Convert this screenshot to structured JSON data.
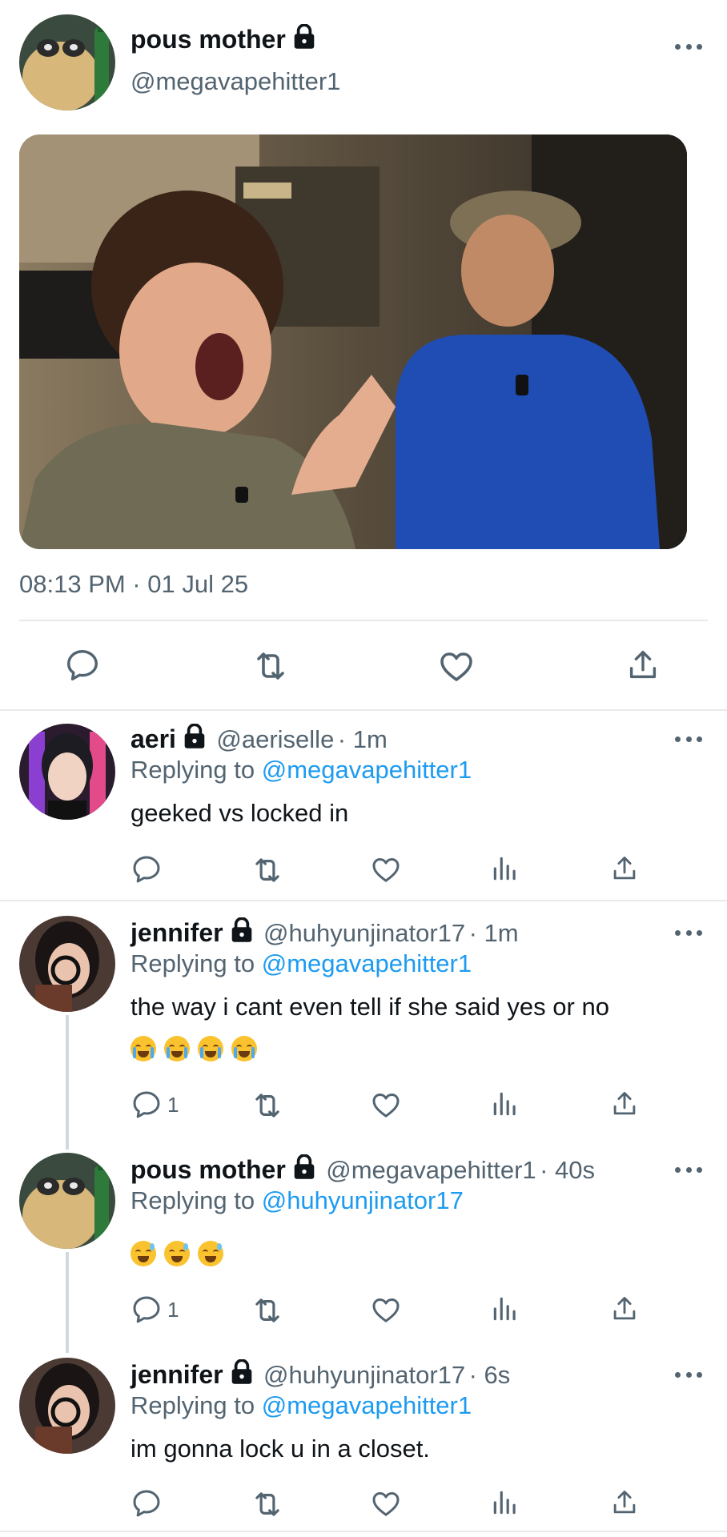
{
  "main_tweet": {
    "author_name": "pous mother",
    "handle": "@megavapehitter1",
    "timestamp": "08:13 PM · 01 Jul 25",
    "image_alt": "photo of two young men, one yelling at the camera, one in a blue shirt and cap"
  },
  "replies": [
    {
      "name": "aeri",
      "handle": "@aeriselle",
      "time": "· 1m",
      "replying_label": "Replying to",
      "replying_to": "@megavapehitter1",
      "text": "geeked vs locked in",
      "reply_count": ""
    },
    {
      "name": "jennifer",
      "handle": "@huhyunjinator17",
      "time": "· 1m",
      "replying_label": "Replying to",
      "replying_to": "@megavapehitter1",
      "text": "the way i cant even tell if she said yes or no",
      "emojis": [
        "loudly-crying-face",
        "loudly-crying-face",
        "loudly-crying-face",
        "loudly-crying-face"
      ],
      "reply_count": "1"
    },
    {
      "name": "pous mother",
      "handle": "@megavapehitter1",
      "time": "· 40s",
      "replying_label": "Replying to",
      "replying_to": "@huhyunjinator17",
      "emojis": [
        "grinning-sweat-face",
        "grinning-sweat-face",
        "grinning-sweat-face"
      ],
      "reply_count": "1"
    },
    {
      "name": "jennifer",
      "handle": "@huhyunjinator17",
      "time": "· 6s",
      "replying_label": "Replying to",
      "replying_to": "@megavapehitter1",
      "text": "im gonna lock u in a closet.",
      "reply_count": ""
    }
  ],
  "colors": {
    "text": "#0f1419",
    "secondary": "#536471",
    "link": "#1d9bf0",
    "divider": "#e7e9ea"
  },
  "icons": [
    "lock-icon",
    "more-icon",
    "reply-icon",
    "retweet-icon",
    "like-icon",
    "share-icon",
    "views-icon"
  ]
}
